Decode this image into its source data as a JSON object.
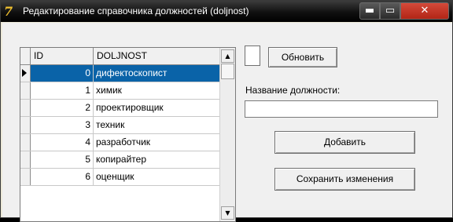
{
  "window": {
    "title": "Редактирование справочника должностей (doljnost)",
    "app_icon": "delphi-icon",
    "controls": {
      "minimize": "▬",
      "maximize": "▭",
      "close": "✕"
    }
  },
  "grid": {
    "columns": [
      "ID",
      "DOLJNOST"
    ],
    "rows": [
      {
        "id": "0",
        "name": "дифектоскопист",
        "selected": true
      },
      {
        "id": "1",
        "name": "химик"
      },
      {
        "id": "2",
        "name": "проектировщик"
      },
      {
        "id": "3",
        "name": "техник"
      },
      {
        "id": "4",
        "name": "разработчик"
      },
      {
        "id": "5",
        "name": "копирайтер"
      },
      {
        "id": "6",
        "name": "оценщик"
      }
    ],
    "scroll_up": "▲",
    "scroll_down": "▼"
  },
  "controls": {
    "refresh_label": "Обновить",
    "position_label": "Название должности:",
    "position_value": "",
    "add_label": "Добавить",
    "save_label": "Сохранить изменения"
  }
}
